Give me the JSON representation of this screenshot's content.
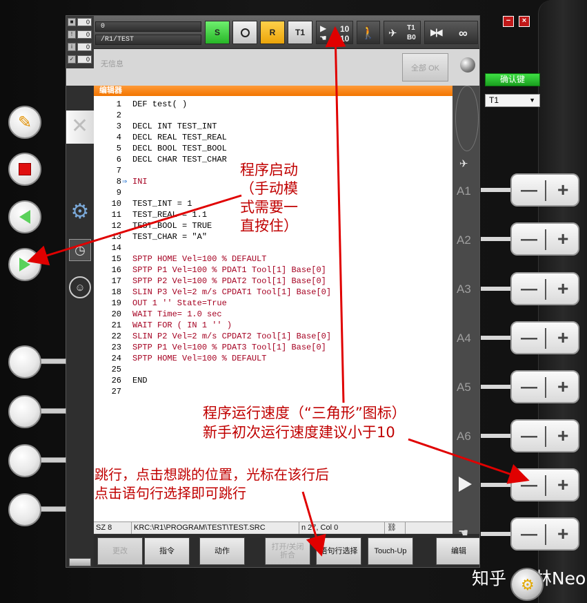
{
  "topbar": {
    "robot_status": "0",
    "robot_path": "/R1/TEST",
    "btn_s": "S",
    "btn_r": "R",
    "btn_t1": "T1",
    "override_program": "10",
    "override_jog": "10",
    "tool_label": "T1",
    "base_label": "B0",
    "increment": "∞"
  },
  "messages": {
    "counts": [
      "0",
      "0",
      "0",
      "0"
    ],
    "text": "无信息",
    "all_ok": "全部 OK"
  },
  "editor": {
    "title": "编辑器",
    "lines": [
      {
        "n": "1",
        "code": "DEF test( )",
        "style": "mix"
      },
      {
        "n": "2",
        "code": "",
        "style": "mix"
      },
      {
        "n": "3",
        "code": "DECL INT TEST_INT",
        "style": "mix"
      },
      {
        "n": "4",
        "code": "DECL REAL TEST_REAL",
        "style": "mix"
      },
      {
        "n": "5",
        "code": "DECL BOOL TEST_BOOL",
        "style": "mix"
      },
      {
        "n": "6",
        "code": "DECL CHAR TEST_CHAR",
        "style": "mix"
      },
      {
        "n": "7",
        "code": "",
        "style": "mix"
      },
      {
        "n": "8",
        "code": "INI",
        "style": "red"
      },
      {
        "n": "9",
        "code": "",
        "style": "mix"
      },
      {
        "n": "10",
        "code": "TEST_INT = 1",
        "style": "mix"
      },
      {
        "n": "11",
        "code": "TEST_REAL = 1.1",
        "style": "mix"
      },
      {
        "n": "12",
        "code": "TEST_BOOL = TRUE",
        "style": "mix"
      },
      {
        "n": "13",
        "code": "TEST_CHAR = \"A\"",
        "style": "mix"
      },
      {
        "n": "14",
        "code": "",
        "style": "mix"
      },
      {
        "n": "15",
        "code": "SPTP HOME Vel=100 % DEFAULT",
        "style": "red"
      },
      {
        "n": "16",
        "code": "SPTP P1 Vel=100 % PDAT1 Tool[1] Base[0]",
        "style": "red"
      },
      {
        "n": "17",
        "code": "SPTP P2 Vel=100 % PDAT2 Tool[1] Base[0]",
        "style": "red"
      },
      {
        "n": "18",
        "code": "SLIN P3 Vel=2 m/s CPDAT1 Tool[1] Base[0]",
        "style": "red"
      },
      {
        "n": "19",
        "code": "OUT 1 '' State=True",
        "style": "red"
      },
      {
        "n": "20",
        "code": "WAIT Time= 1.0 sec",
        "style": "red"
      },
      {
        "n": "21",
        "code": "WAIT FOR ( IN 1 '' )",
        "style": "red"
      },
      {
        "n": "22",
        "code": "SLIN P2 Vel=2 m/s CPDAT2 Tool[1] Base[0]",
        "style": "red"
      },
      {
        "n": "23",
        "code": "SPTP P1 Vel=100 % PDAT3 Tool[1] Base[0]",
        "style": "red"
      },
      {
        "n": "24",
        "code": "SPTP HOME Vel=100 % DEFAULT",
        "style": "red"
      },
      {
        "n": "25",
        "code": "",
        "style": "mix"
      },
      {
        "n": "26",
        "code": "END",
        "style": "mix"
      },
      {
        "n": "27",
        "code": "",
        "style": "mix"
      }
    ]
  },
  "statusbar": {
    "size": "SZ 8",
    "path": "KRC:\\R1\\PROGRAM\\TEST\\TEST.SRC",
    "position": "n 27, Col 0"
  },
  "softkeys": [
    {
      "label": "更改",
      "disabled": true
    },
    {
      "label": "指令",
      "disabled": false
    },
    {
      "label": "动作",
      "disabled": false
    },
    {
      "label": "打开/关闭\n折合",
      "disabled": true
    },
    {
      "label": "语句行选择",
      "disabled": false
    },
    {
      "label": "Touch-Up",
      "disabled": false
    },
    {
      "label": "编辑",
      "disabled": false
    }
  ],
  "axes": [
    "A1",
    "A2",
    "A3",
    "A4",
    "A5",
    "A6"
  ],
  "right_panel": {
    "confirm": "确认键",
    "mode": "T1"
  },
  "annotations": {
    "start": [
      "程序启动",
      "（手动模",
      "式需要一",
      "直按住）"
    ],
    "speed": [
      "程序运行速度（“三角形”图标）",
      "新手初次运行速度建议小于10"
    ],
    "jump": [
      "跳行，点击想跳的位置，光标在该行后",
      "点击语句行选择即可跳行"
    ]
  },
  "watermark": "知乎 @ 林Neo",
  "colors": {
    "editor_bar": "#f27500",
    "annotation": "#c00000",
    "code_keyword": "#a50021"
  }
}
